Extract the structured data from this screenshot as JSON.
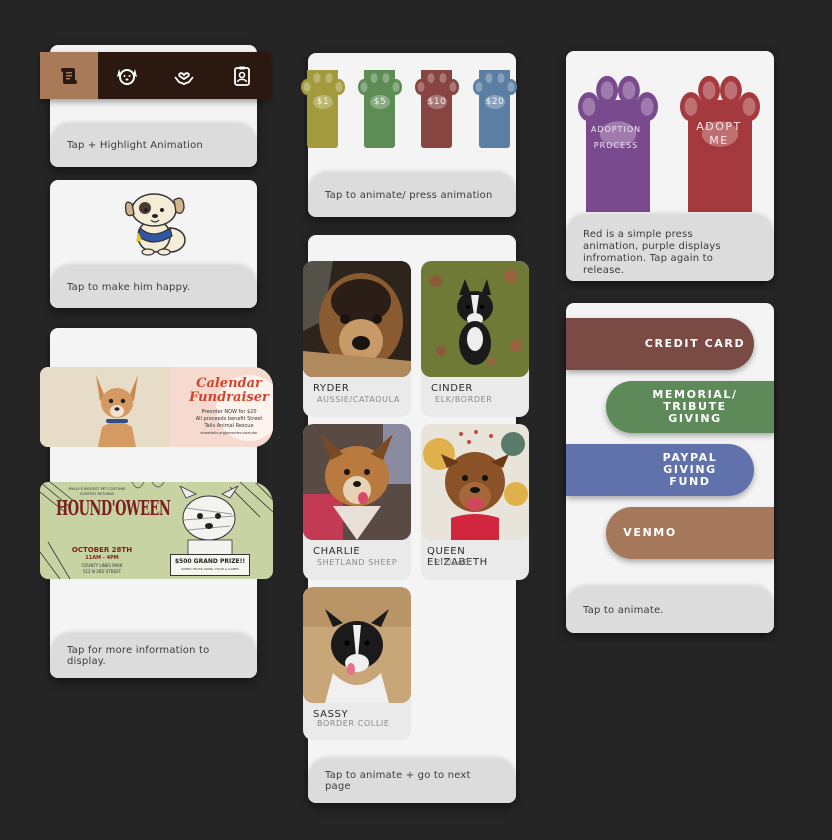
{
  "nav": {
    "items": [
      {
        "icon": "scroll-icon",
        "active": true
      },
      {
        "icon": "dog-face-icon",
        "active": false
      },
      {
        "icon": "heart-hands-icon",
        "active": false
      },
      {
        "icon": "contact-card-icon",
        "active": false
      }
    ],
    "caption": "Tap + Highlight Animation"
  },
  "mascot": {
    "caption": "Tap to make him happy."
  },
  "events": {
    "calendar_title": "Calendar Fundraiser",
    "calendar_line1": "Preorder NOW for $20",
    "calendar_line2": "All proceeds benefit Street",
    "calendar_line3": "Tails Animal Rescue",
    "calendar_url": "streettails.org/preorder-calendar",
    "houndoween_small": "PHILLY'S BIGGEST PET COSTUME CONTEST RETURNS",
    "houndoween_title": "HOUND'OWEEN",
    "houndoween_date": "OCTOBER 28TH",
    "houndoween_time": "11AM - 4PM",
    "houndoween_place": "COUNTY LINES PARK",
    "houndoween_address": "512 N 3RD STREET",
    "houndoween_prize": "$500 GRAND PRIZE!!",
    "houndoween_prize_sub": "SUPPLY TRUCK SWIRL, FOOD & GAMES",
    "caption": "Tap for more information to display."
  },
  "donate": {
    "amounts": [
      "$1",
      "$5",
      "$10",
      "$20"
    ],
    "colors": [
      "#a39a3e",
      "#5d8c55",
      "#874440",
      "#5b7ea3"
    ],
    "caption": "Tap to animate/ press animation"
  },
  "dogs": {
    "items": [
      {
        "name": "RYDER",
        "breed": "AUSSIE/CATAOULA"
      },
      {
        "name": "CINDER",
        "breed": "ELK/BORDER"
      },
      {
        "name": "CHARLIE",
        "breed": "SHETLAND SHEEP"
      },
      {
        "name": "QUEEN ELIZABETH",
        "breed": "PIT/LAB"
      },
      {
        "name": "SASSY",
        "breed": "BORDER COLLIE"
      }
    ],
    "caption": "Tap to animate + go to next page"
  },
  "adopt": {
    "process_label": "ADOPTION PROCESS",
    "adopt_label": "ADOPT ME",
    "colors": [
      "#7a4a8e",
      "#a53a3e"
    ],
    "caption": "Red is a simple press animation, purple displays infromation. Tap again to release."
  },
  "payment": {
    "options": [
      "CREDIT CARD",
      "MEMORIAL/ TRIBUTE GIVING",
      "PAYPAL GIVING FUND",
      "VENMO"
    ],
    "colors": [
      "#7a4a45",
      "#5e8a5a",
      "#6071ac",
      "#a5775b"
    ],
    "caption": "Tap to animate."
  }
}
